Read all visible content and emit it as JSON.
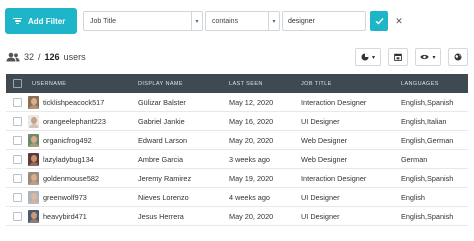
{
  "filter": {
    "add_label": "Add Filter",
    "field": "Job Title",
    "operator": "contains",
    "value": "designer",
    "colors": {
      "accent": "#1fb5c9"
    }
  },
  "summary": {
    "shown": "32",
    "separator": "/",
    "total": "126",
    "unit": "users"
  },
  "toolbar": {
    "chart_icon": "pie-chart-icon",
    "calendar_icon": "calendar-icon",
    "visibility_icon": "eye-icon",
    "locale_icon": "globe-icon"
  },
  "table": {
    "headers": [
      "USERNAME",
      "DISPLAY NAME",
      "LAST SEEN",
      "JOB TITLE",
      "LANGUAGES"
    ],
    "header_bg": "#3f4951",
    "rows": [
      {
        "username": "ticklishpeacock517",
        "display_name": "Gülizar Balster",
        "last_seen": "May 12, 2020",
        "job_title": "Interaction Designer",
        "languages": "English,Spanish",
        "avatar_bg": "#8a6f57",
        "avatar_face": "#d9b08c"
      },
      {
        "username": "orangeelephant223",
        "display_name": "Gabriel Jankie",
        "last_seen": "May 16, 2020",
        "job_title": "UI Designer",
        "languages": "English,Italian",
        "avatar_bg": "#e8e8e8",
        "avatar_face": "#c9a184"
      },
      {
        "username": "organicfrog492",
        "display_name": "Edward Larson",
        "last_seen": "May 20, 2020",
        "job_title": "Web Designer",
        "languages": "English,German",
        "avatar_bg": "#6c8a6a",
        "avatar_face": "#d7ad8c"
      },
      {
        "username": "lazyladybug134",
        "display_name": "Ambre Garcia",
        "last_seen": "3 weeks ago",
        "job_title": "Web Designer",
        "languages": "German",
        "avatar_bg": "#5a3a3a",
        "avatar_face": "#c9906f"
      },
      {
        "username": "goldenmouse582",
        "display_name": "Jeremy Ramirez",
        "last_seen": "May 19, 2020",
        "job_title": "Interaction Designer",
        "languages": "English,Spanish",
        "avatar_bg": "#9a8a7a",
        "avatar_face": "#d8ae8e"
      },
      {
        "username": "greenwolf973",
        "display_name": "Nieves Lorenzo",
        "last_seen": "4 weeks ago",
        "job_title": "UI Designer",
        "languages": "English",
        "avatar_bg": "#a8b4c0",
        "avatar_face": "#e0b99a"
      },
      {
        "username": "heavybird471",
        "display_name": "Jesus Herrera",
        "last_seen": "May 20, 2020",
        "job_title": "UI Designer",
        "languages": "English,Spanish",
        "avatar_bg": "#4a5a70",
        "avatar_face": "#c99a78"
      }
    ]
  }
}
